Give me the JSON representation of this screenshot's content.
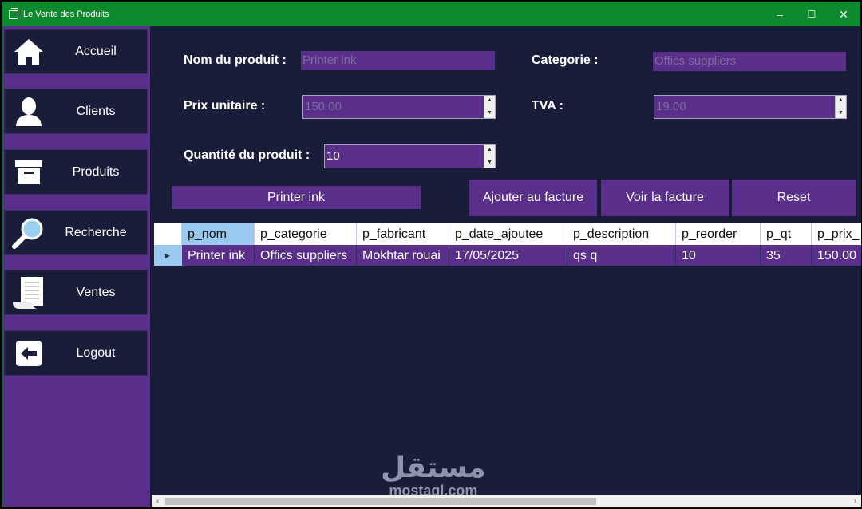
{
  "window": {
    "title": "Le Vente des Produits",
    "min": "–",
    "max": "☐",
    "close": "✕"
  },
  "sidebar": {
    "items": [
      {
        "label": "Accueil",
        "icon": "home-icon"
      },
      {
        "label": "Clients",
        "icon": "user-icon"
      },
      {
        "label": "Produits",
        "icon": "box-icon"
      },
      {
        "label": "Recherche",
        "icon": "magnifier-icon"
      },
      {
        "label": "Ventes",
        "icon": "receipt-icon"
      },
      {
        "label": "Logout",
        "icon": "logout-arrow-icon"
      }
    ]
  },
  "form": {
    "nom_label": "Nom du produit :",
    "nom_value": "Printer ink",
    "categorie_label": "Categorie :",
    "categorie_value": "Offics suppliers",
    "prix_label": "Prix unitaire :",
    "prix_value": "150.00",
    "tva_label": "TVA :",
    "tva_value": "19.00",
    "qte_label": "Quantité du produit :",
    "qte_value": "10"
  },
  "actions": {
    "product_name_button": "Printer ink",
    "ajouter": "Ajouter au facture",
    "voir": "Voir la facture",
    "reset": "Reset"
  },
  "grid": {
    "columns": [
      "p_nom",
      "p_categorie",
      "p_fabricant",
      "p_date_ajoutee",
      "p_description",
      "p_reorder",
      "p_qt",
      "p_prix_"
    ],
    "rows": [
      [
        "Printer ink",
        "Offics suppliers",
        "Mokhtar rouai",
        "17/05/2025",
        "qs q",
        "10",
        "35",
        "150.00"
      ]
    ]
  },
  "watermark": {
    "arabic": "مستقل",
    "latin": "mostaql.com"
  },
  "colors": {
    "titlebar": "#0d8a2e",
    "sidebar": "#5a2f8c",
    "panel": "#1a1d3a",
    "accent": "#99c9ef"
  }
}
